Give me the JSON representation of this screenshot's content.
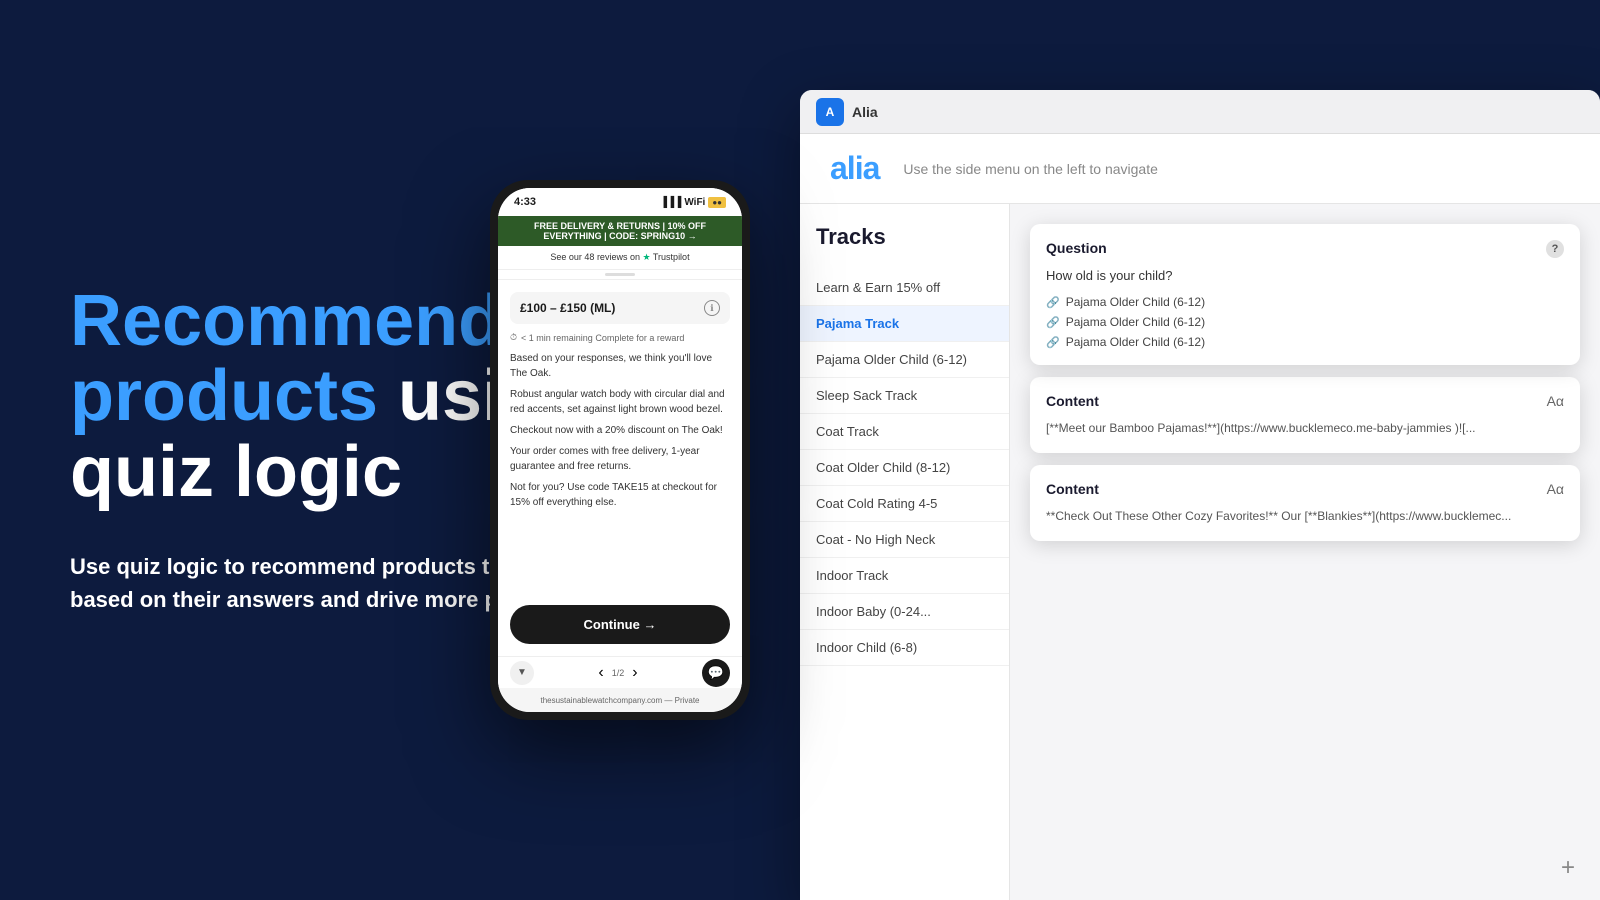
{
  "background": "#0d1b3e",
  "left": {
    "headline_line1_blue": "Recommend",
    "headline_line2_blue": "products",
    "headline_line2_white": " using",
    "headline_line3": "quiz logic",
    "subtext": "Use quiz logic to recommend products to shoppers based on their answers and drive more purchases."
  },
  "browser": {
    "tab_label": "Alia",
    "logo": "alia",
    "nav_hint": "Use the side menu on the left to navigate",
    "tracks_title": "Tracks",
    "tracks": [
      {
        "label": "Learn & Earn 15% off",
        "active": false
      },
      {
        "label": "Pajama Track",
        "active": true
      },
      {
        "label": "Pajama Older Child (6-12)",
        "active": false
      },
      {
        "label": "Sleep Sack Track",
        "active": false
      },
      {
        "label": "Coat Track",
        "active": false
      },
      {
        "label": "Coat Older Child (8-12)",
        "active": false
      },
      {
        "label": "Coat Cold Rating 4-5",
        "active": false
      },
      {
        "label": "Coat - No High Neck",
        "active": false
      },
      {
        "label": "Indoor Track",
        "active": false
      },
      {
        "label": "Indoor Baby (0-24...",
        "active": false
      },
      {
        "label": "Indoor Child (6-8)",
        "active": false
      }
    ],
    "popup": {
      "type": "Question",
      "question": "How old is your child?",
      "tags": [
        "Pajama Older Child (6-12)",
        "Pajama Older Child (6-12)",
        "Pajama Older Child (6-12)"
      ]
    },
    "content1": {
      "type": "Content",
      "text": "[**Meet our Bamboo Pajamas!**](https://www.bucklemeco.me-baby-jammies )![..."
    },
    "content2": {
      "type": "Content",
      "text": "**Check Out These Other Cozy Favorites!** Our [**Blankies**](https://www.bucklemec..."
    },
    "add_button": "+"
  },
  "phone": {
    "time": "4:33",
    "banner": "FREE DELIVERY & RETURNS | 10% OFF EVERYTHING | CODE: SPRING10 →",
    "trustpilot": "See our 48 reviews on ★ Trustpilot",
    "product_title": "£100 – £150 (ML)",
    "timer_text": "< 1 min remaining  Complete for a reward",
    "description_1": "Based on your responses, we think you'll love The Oak.",
    "description_2": "Robust angular watch body with circular dial and red accents, set against light brown wood bezel.",
    "description_3": "Checkout now with a 20% discount on The Oak!",
    "description_4": "Your order comes with free delivery, 1-year guarantee and free returns.",
    "description_5": "Not for you? Use code TAKE15 at checkout for 15% off everything else.",
    "cta": "Continue →",
    "page_indicator": "1/2",
    "url": "thesustainablewatchcompany.com — Private"
  }
}
